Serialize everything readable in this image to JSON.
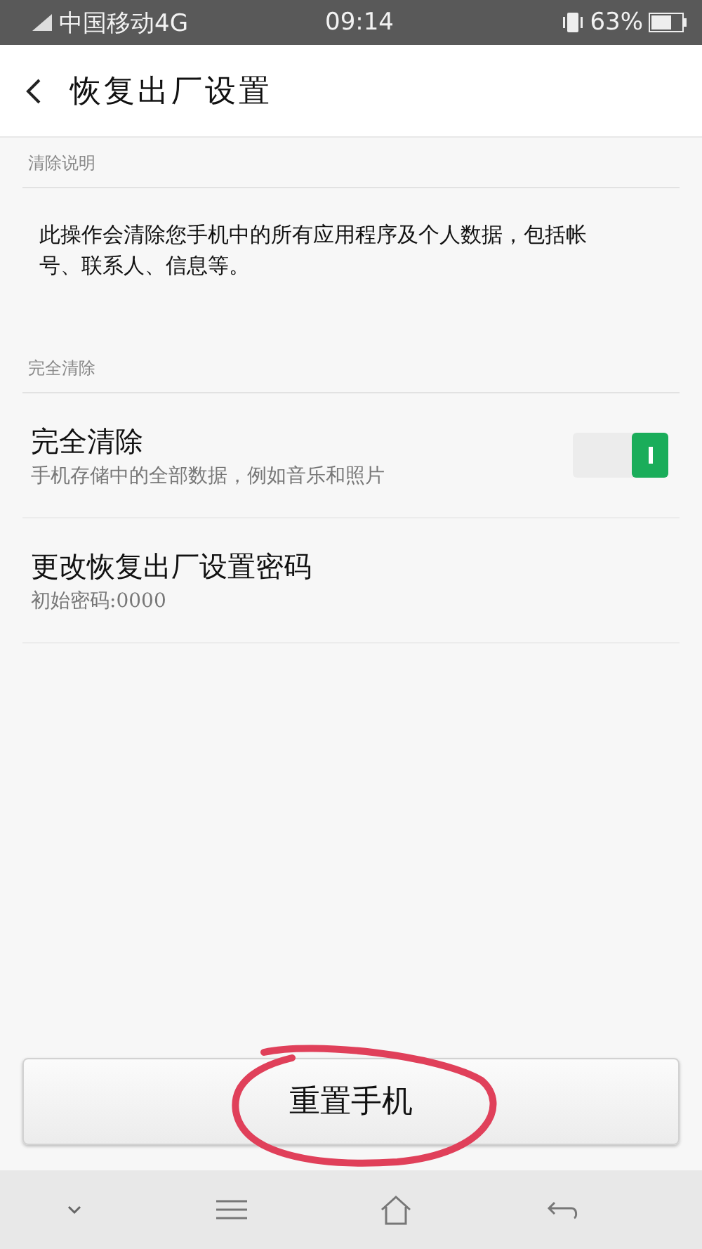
{
  "status_bar": {
    "carrier": "中国移动4G",
    "time": "09:14",
    "battery": "63%"
  },
  "header": {
    "title": "恢复出厂设置"
  },
  "sections": [
    {
      "heading": "清除说明",
      "kind": "text",
      "text": "此操作会清除您手机中的所有应用程序及个人数据，包括帐号、联系人、信息等。"
    },
    {
      "heading": "完全清除",
      "kind": "options",
      "options": [
        {
          "kind": "toggle",
          "title": "完全清除",
          "subtitle": "手机存储中的全部数据，例如音乐和照片",
          "checked": true
        },
        {
          "kind": "link",
          "title": "更改恢复出厂设置密码",
          "subtitle": "初始密码:0000"
        }
      ]
    }
  ],
  "reset_button": {
    "label": "重置手机",
    "annotated": true
  }
}
